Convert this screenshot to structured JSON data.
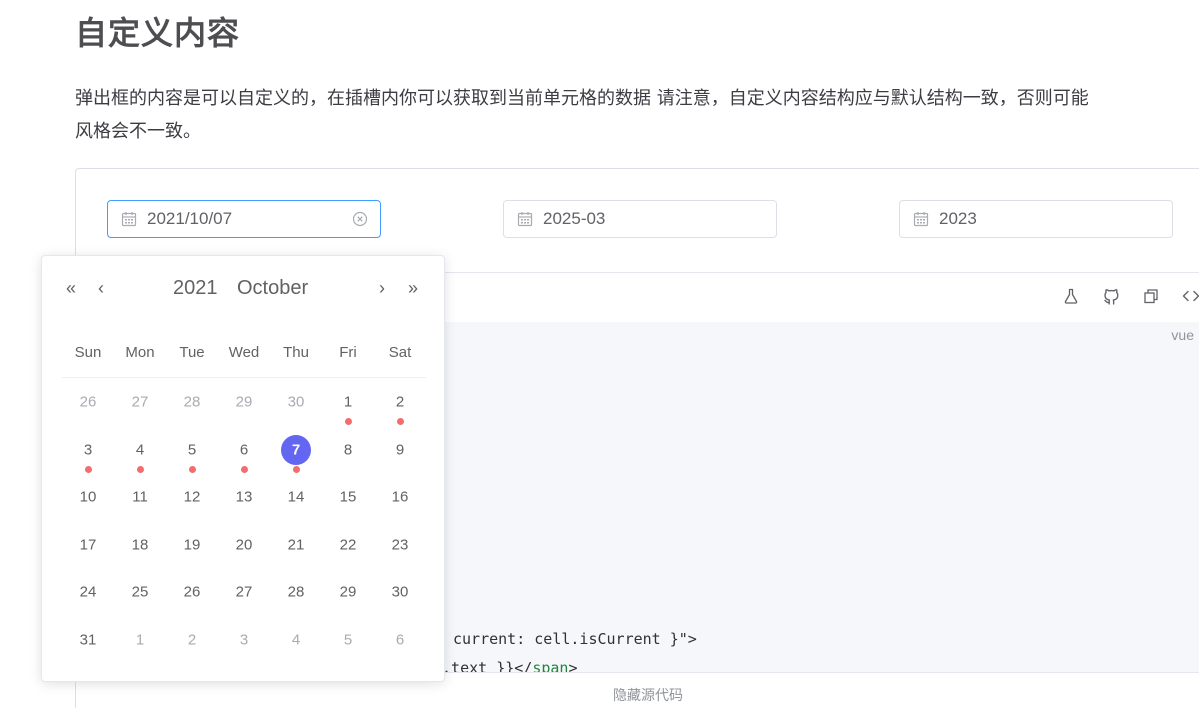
{
  "page": {
    "title": "自定义内容",
    "description_line1": "弹出框的内容是可以自定义的，在插槽内你可以获取到当前单元格的数据 请注意，自定义内容结构应与默认结构一致，否则可能",
    "description_line2": "风格会不一致。"
  },
  "pickers": [
    {
      "value": "2021/10/07",
      "focused": true,
      "icon": "calendar-icon"
    },
    {
      "value": "2025-03",
      "focused": false,
      "icon": "calendar-icon"
    },
    {
      "value": "2023",
      "focused": false,
      "icon": "calendar-icon"
    }
  ],
  "toolbar": {
    "icons": [
      "flask-icon",
      "github-icon",
      "copy-icon",
      "code-icon"
    ]
  },
  "code": {
    "lang": "vue",
    "line1": "current: cell.isCurrent }\">",
    "line2_pre": "l.text }}</",
    "line2_tag": "span",
    "line2_post": ">"
  },
  "footer": {
    "label": "隐藏源代码"
  },
  "calendar": {
    "year": "2021",
    "month": "October",
    "nav": {
      "prev_year": "«",
      "prev_month": "‹",
      "next_month": "›",
      "next_year": "»"
    },
    "weekdays": [
      "Sun",
      "Mon",
      "Tue",
      "Wed",
      "Thu",
      "Fri",
      "Sat"
    ],
    "weeks": [
      [
        {
          "d": "26",
          "o": true
        },
        {
          "d": "27",
          "o": true
        },
        {
          "d": "28",
          "o": true
        },
        {
          "d": "29",
          "o": true
        },
        {
          "d": "30",
          "o": true
        },
        {
          "d": "1",
          "dot": true
        },
        {
          "d": "2",
          "dot": true
        }
      ],
      [
        {
          "d": "3",
          "dot": true
        },
        {
          "d": "4",
          "dot": true
        },
        {
          "d": "5",
          "dot": true
        },
        {
          "d": "6",
          "dot": true
        },
        {
          "d": "7",
          "dot": true,
          "sel": true
        },
        {
          "d": "8"
        },
        {
          "d": "9"
        }
      ],
      [
        {
          "d": "10"
        },
        {
          "d": "11"
        },
        {
          "d": "12"
        },
        {
          "d": "13"
        },
        {
          "d": "14"
        },
        {
          "d": "15"
        },
        {
          "d": "16"
        }
      ],
      [
        {
          "d": "17"
        },
        {
          "d": "18"
        },
        {
          "d": "19"
        },
        {
          "d": "20"
        },
        {
          "d": "21"
        },
        {
          "d": "22"
        },
        {
          "d": "23"
        }
      ],
      [
        {
          "d": "24"
        },
        {
          "d": "25"
        },
        {
          "d": "26"
        },
        {
          "d": "27"
        },
        {
          "d": "28"
        },
        {
          "d": "29"
        },
        {
          "d": "30"
        }
      ],
      [
        {
          "d": "31"
        },
        {
          "d": "1",
          "o": true
        },
        {
          "d": "2",
          "o": true
        },
        {
          "d": "3",
          "o": true
        },
        {
          "d": "4",
          "o": true
        },
        {
          "d": "5",
          "o": true
        },
        {
          "d": "6",
          "o": true
        }
      ]
    ],
    "colors": {
      "selected": "#6366f1",
      "dot": "#f56c6c"
    }
  }
}
